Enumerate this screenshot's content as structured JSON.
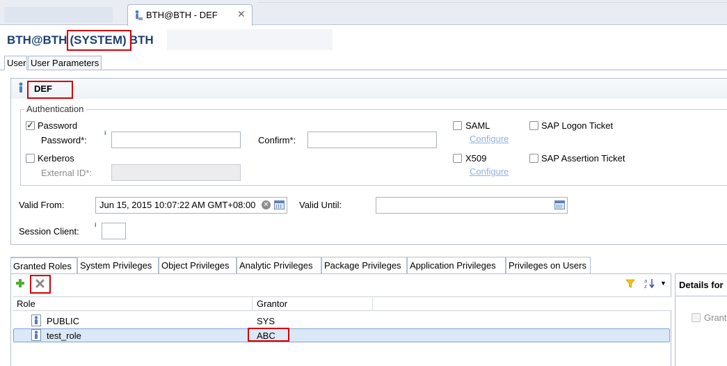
{
  "editor_tab": {
    "label": "BTH@BTH - DEF",
    "close": "✕"
  },
  "header": {
    "user": "BTH@BTH",
    "system": "(SYSTEM)",
    "suffix": "BTH"
  },
  "subtabs": [
    {
      "label": "User"
    },
    {
      "label": "User Parameters"
    }
  ],
  "user": {
    "name": "DEF"
  },
  "authentication": {
    "title": "Authentication",
    "password": {
      "label": "Password",
      "checked": true,
      "field_label": "Password*:",
      "confirm_label": "Confirm*:",
      "value": "",
      "confirm_value": ""
    },
    "kerberos": {
      "label": "Kerberos",
      "checked": false,
      "field_label": "External ID*:",
      "value": ""
    },
    "saml": {
      "label": "SAML",
      "checked": false,
      "configure": "Configure"
    },
    "x509": {
      "label": "X509",
      "checked": false,
      "configure": "Configure"
    },
    "sap_logon_ticket": {
      "label": "SAP Logon Ticket",
      "checked": false
    },
    "sap_assertion_ticket": {
      "label": "SAP Assertion Ticket",
      "checked": false
    }
  },
  "validity": {
    "from_label": "Valid From:",
    "from_value": "Jun 15, 2015 10:07:22 AM GMT+08:00",
    "until_label": "Valid Until:",
    "until_value": ""
  },
  "session_client": {
    "label": "Session Client:",
    "value": ""
  },
  "bottom_tabs": [
    {
      "label": "Granted Roles"
    },
    {
      "label": "System Privileges"
    },
    {
      "label": "Object Privileges"
    },
    {
      "label": "Analytic Privileges"
    },
    {
      "label": "Package Privileges"
    },
    {
      "label": "Application Privileges"
    },
    {
      "label": "Privileges on Users"
    }
  ],
  "roles_table": {
    "columns": [
      "Role",
      "Grantor"
    ],
    "rows": [
      {
        "role": "PUBLIC",
        "grantor": "SYS"
      },
      {
        "role": "test_role",
        "grantor": "ABC"
      }
    ]
  },
  "details": {
    "title": "Details for",
    "grant_option": "Grant"
  }
}
